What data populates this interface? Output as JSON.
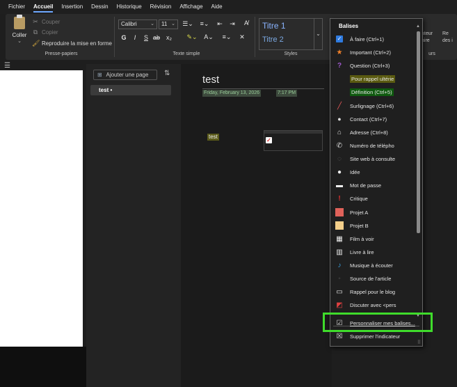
{
  "menubar": {
    "items": [
      "Fichier",
      "Accueil",
      "Insertion",
      "Dessin",
      "Historique",
      "Révision",
      "Affichage",
      "Aide"
    ],
    "active": "Accueil"
  },
  "ribbon": {
    "clipboard": {
      "paste": "Coller",
      "cut": "Couper",
      "copy": "Copier",
      "format_painter": "Reproduire la mise en forme",
      "label": "Presse-papiers"
    },
    "font": {
      "family": "Calibri",
      "size": "11",
      "bold": "G",
      "italic": "I",
      "underline": "S",
      "strike": "ab",
      "subscript": "x₂",
      "label": "Texte simple"
    },
    "styles": {
      "items": [
        "Titre 1",
        "Titre 2"
      ],
      "label": "Styles"
    },
    "partial_right": [
      "ateur",
      "aire"
    ],
    "partial_right2": [
      "Re",
      "des i"
    ],
    "partial_label": "urs"
  },
  "pages": {
    "add_label": "Ajouter une page",
    "items": [
      "test"
    ]
  },
  "canvas": {
    "title": "test",
    "date": "Friday, February 13, 2026",
    "time": "7:17 PM",
    "note_text": "test"
  },
  "tags": {
    "header": "Balises",
    "items": [
      {
        "label": "À faire (Ctrl+1)",
        "icon": "checkbox-icon"
      },
      {
        "label": "Important (Ctrl+2)",
        "icon": "star-icon"
      },
      {
        "label": "Question (Ctrl+3)",
        "icon": "question-icon"
      },
      {
        "label": "Pour rappel ultérie",
        "icon": "none",
        "highlight": "#5a5a10"
      },
      {
        "label": "Définition (Ctrl+5)",
        "icon": "none",
        "highlight": "#0f5a0f"
      },
      {
        "label": "Surlignage (Ctrl+6)",
        "icon": "highlighter-icon"
      },
      {
        "label": "Contact (Ctrl+7)",
        "icon": "contact-icon"
      },
      {
        "label": "Adresse (Ctrl+8)",
        "icon": "home-icon"
      },
      {
        "label": "Numéro de télépho",
        "icon": "phone-icon"
      },
      {
        "label": "Site web à consulte",
        "icon": "globe-icon"
      },
      {
        "label": "Idée",
        "icon": "lightbulb-icon"
      },
      {
        "label": "Mot de passe",
        "icon": "key-icon"
      },
      {
        "label": "Critique",
        "icon": "exclamation-icon"
      },
      {
        "label": "Projet A",
        "icon": "red-square-icon"
      },
      {
        "label": "Projet B",
        "icon": "yellow-square-icon"
      },
      {
        "label": "Film à voir",
        "icon": "film-icon"
      },
      {
        "label": "Livre à lire",
        "icon": "book-icon"
      },
      {
        "label": "Musique à écouter",
        "icon": "music-icon"
      },
      {
        "label": "Source de l'article",
        "icon": "link-icon"
      },
      {
        "label": "Rappel pour le blog",
        "icon": "comment-icon"
      },
      {
        "label": "Discuter avec <pers",
        "icon": "discuss-icon"
      }
    ],
    "customize": "Personnaliser mes balises...",
    "remove": "Supprimer l'indicateur"
  },
  "colors": {
    "accent": "#6ea8ff",
    "highlight_box": "#3fdc2b"
  }
}
